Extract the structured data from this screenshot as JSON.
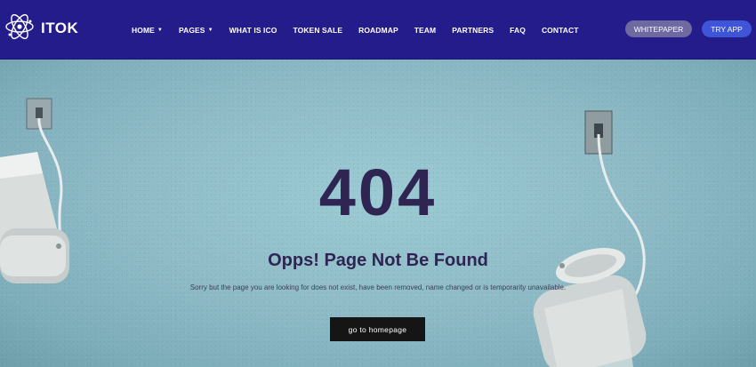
{
  "brand": {
    "name": "ITOK"
  },
  "nav": {
    "items": [
      {
        "label": "HOME",
        "dropdown": true
      },
      {
        "label": "PAGES",
        "dropdown": true
      },
      {
        "label": "WHAT IS ICO",
        "dropdown": false
      },
      {
        "label": "TOKEN SALE",
        "dropdown": false
      },
      {
        "label": "ROADMAP",
        "dropdown": false
      },
      {
        "label": "TEAM",
        "dropdown": false
      },
      {
        "label": "PARTNERS",
        "dropdown": false
      },
      {
        "label": "FAQ",
        "dropdown": false
      },
      {
        "label": "CONTACT",
        "dropdown": false
      }
    ],
    "caret_icon": "chevron-down-icon"
  },
  "header_buttons": {
    "whitepaper": "WHITEPAPER",
    "try_app": "TRY APP"
  },
  "error": {
    "code": "404",
    "title": "Opps! Page Not Be Found",
    "description": "Sorry but the page you are looking for does not exist, have been removed, name changed or is temporarity unavailable.",
    "button": "go to homepage"
  },
  "colors": {
    "header_bg": "#251c8c",
    "accent_button": "#3d55d6",
    "muted_button": "#6e6aa0",
    "heading_text": "#2f2553",
    "wall": "#8fbcc7",
    "cta_button": "#151515"
  },
  "icons": {
    "logo": "atom-logo-icon"
  }
}
